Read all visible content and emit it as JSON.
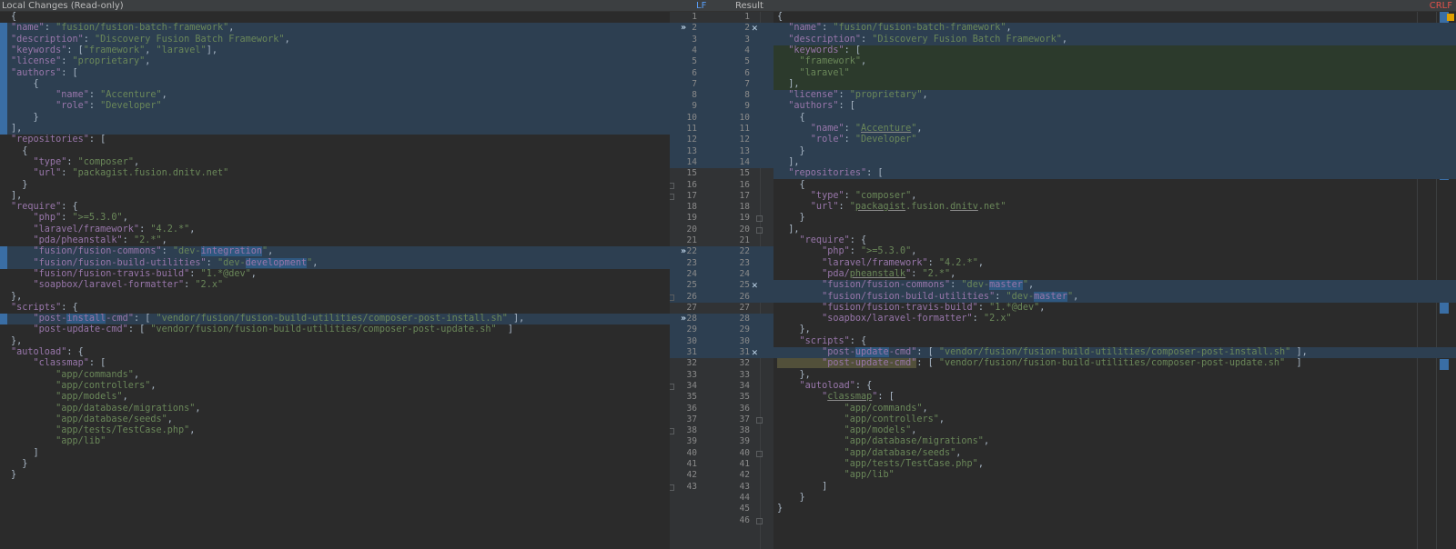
{
  "headers": {
    "left_title": "Local Changes (Read-only)",
    "middle_label": "LF",
    "result_label": "Result",
    "right_label": "CRLF"
  },
  "colors": {
    "accent": "#589df6",
    "changed_band": "#2d3f51",
    "inserted_band": "#2c3a2c",
    "warning": "#e0514b"
  },
  "left_lines": [
    [
      [
        "p",
        "{"
      ]
    ],
    [
      [
        "k",
        "\"name\""
      ],
      [
        "p",
        ": "
      ],
      [
        "s",
        "\"fusion/fusion-batch-framework\""
      ],
      [
        "p",
        ","
      ]
    ],
    [
      [
        "k",
        "\"description\""
      ],
      [
        "p",
        ": "
      ],
      [
        "s",
        "\"Discovery Fusion Batch Framework\""
      ],
      [
        "p",
        ","
      ]
    ],
    [
      [
        "k",
        "\"keywords\""
      ],
      [
        "p",
        ": ["
      ],
      [
        "s",
        "\"framework\""
      ],
      [
        "p",
        ", "
      ],
      [
        "s",
        "\"laravel\""
      ],
      [
        "p",
        "],"
      ]
    ],
    [
      [
        "k",
        "\"license\""
      ],
      [
        "p",
        ": "
      ],
      [
        "s",
        "\"proprietary\""
      ],
      [
        "p",
        ","
      ]
    ],
    [
      [
        "k",
        "\"authors\""
      ],
      [
        "p",
        ": ["
      ]
    ],
    [
      [
        "p",
        "    {"
      ]
    ],
    [
      [
        "k",
        "        \"name\""
      ],
      [
        "p",
        ": "
      ],
      [
        "s",
        "\"Accenture\""
      ],
      [
        "p",
        ","
      ]
    ],
    [
      [
        "k",
        "        \"role\""
      ],
      [
        "p",
        ": "
      ],
      [
        "s",
        "\"Developer\""
      ]
    ],
    [
      [
        "p",
        "    }"
      ]
    ],
    [
      [
        "p",
        "],"
      ]
    ],
    [
      [
        "k",
        "\"repositories\""
      ],
      [
        "p",
        ": ["
      ]
    ],
    [
      [
        "p",
        "  {"
      ]
    ],
    [
      [
        "k",
        "    \"type\""
      ],
      [
        "p",
        ": "
      ],
      [
        "s",
        "\"composer\""
      ],
      [
        "p",
        ","
      ]
    ],
    [
      [
        "k",
        "    \"url\""
      ],
      [
        "p",
        ": "
      ],
      [
        "s",
        "\"packagist.fusion.dnitv.net\""
      ]
    ],
    [
      [
        "p",
        "  }"
      ]
    ],
    [
      [
        "p",
        "],"
      ]
    ],
    [
      [
        "k",
        "\"require\""
      ],
      [
        "p",
        ": {"
      ]
    ],
    [
      [
        "k",
        "    \"php\""
      ],
      [
        "p",
        ": "
      ],
      [
        "s",
        "\">=5.3.0\""
      ],
      [
        "p",
        ","
      ]
    ],
    [
      [
        "k",
        "    \"laravel/framework\""
      ],
      [
        "p",
        ": "
      ],
      [
        "s",
        "\"4.2.*\""
      ],
      [
        "p",
        ","
      ]
    ],
    [
      [
        "k",
        "    \"pda/pheanstalk\""
      ],
      [
        "p",
        ": "
      ],
      [
        "s",
        "\"2.*\""
      ],
      [
        "p",
        ","
      ]
    ],
    [
      [
        "k",
        "    \"fusion/fusion-commons\""
      ],
      [
        "p",
        ": "
      ],
      [
        "s",
        "\"dev-"
      ],
      [
        "hl",
        "integration"
      ],
      [
        "s",
        "\""
      ],
      [
        "p",
        ","
      ]
    ],
    [
      [
        "k",
        "    \"fusion/fusion-build-utilities\""
      ],
      [
        "p",
        ": "
      ],
      [
        "s",
        "\"dev-"
      ],
      [
        "hl",
        "development"
      ],
      [
        "s",
        "\""
      ],
      [
        "p",
        ","
      ]
    ],
    [
      [
        "k",
        "    \"fusion/fusion-travis-build\""
      ],
      [
        "p",
        ": "
      ],
      [
        "s",
        "\"1.*@dev\""
      ],
      [
        "p",
        ","
      ]
    ],
    [
      [
        "k",
        "    \"soapbox/laravel-formatter\""
      ],
      [
        "p",
        ": "
      ],
      [
        "s",
        "\"2.x\""
      ]
    ],
    [
      [
        "p",
        "},"
      ]
    ],
    [
      [
        "k",
        "\"scripts\""
      ],
      [
        "p",
        ": {"
      ]
    ],
    [
      [
        "k",
        "    \"post-"
      ],
      [
        "hl",
        "install"
      ],
      [
        "k",
        "-cmd\""
      ],
      [
        "p",
        ": [ "
      ],
      [
        "s",
        "\"vendor/fusion/fusion-build-utilities/composer-post-install.sh\""
      ],
      [
        "p",
        " ],"
      ]
    ],
    [
      [
        "k",
        "    \"post-update-cmd\""
      ],
      [
        "p",
        ": [ "
      ],
      [
        "s",
        "\"vendor/fusion/fusion-build-utilities/composer-post-update.sh\""
      ],
      [
        "p",
        "  ]"
      ]
    ],
    [
      [
        "p",
        "},"
      ]
    ],
    [
      [
        "k",
        "\"autoload\""
      ],
      [
        "p",
        ": {"
      ]
    ],
    [
      [
        "k",
        "    \"classmap\""
      ],
      [
        "p",
        ": ["
      ]
    ],
    [
      [
        "s",
        "        \"app/commands\""
      ],
      [
        "p",
        ","
      ]
    ],
    [
      [
        "s",
        "        \"app/controllers\""
      ],
      [
        "p",
        ","
      ]
    ],
    [
      [
        "s",
        "        \"app/models\""
      ],
      [
        "p",
        ","
      ]
    ],
    [
      [
        "s",
        "        \"app/database/migrations\""
      ],
      [
        "p",
        ","
      ]
    ],
    [
      [
        "s",
        "        \"app/database/seeds\""
      ],
      [
        "p",
        ","
      ]
    ],
    [
      [
        "s",
        "        \"app/tests/TestCase.php\""
      ],
      [
        "p",
        ","
      ]
    ],
    [
      [
        "s",
        "        \"app/lib\""
      ]
    ],
    [
      [
        "p",
        "    ]"
      ]
    ],
    [
      [
        "p",
        "  }"
      ]
    ],
    [
      [
        "p",
        "}"
      ]
    ],
    [
      [
        "p",
        ""
      ]
    ]
  ],
  "right_lines": [
    [
      [
        "p",
        "{"
      ]
    ],
    [
      [
        "k",
        "  \"name\""
      ],
      [
        "p",
        ": "
      ],
      [
        "s",
        "\"fusion/fusion-batch-framework\""
      ],
      [
        "p",
        ","
      ]
    ],
    [
      [
        "k",
        "  \"description\""
      ],
      [
        "p",
        ": "
      ],
      [
        "s",
        "\"Discovery Fusion Batch Framework\""
      ],
      [
        "p",
        ","
      ]
    ],
    [
      [
        "k",
        "  \"keywords\""
      ],
      [
        "p",
        ": ["
      ]
    ],
    [
      [
        "s",
        "    \"framework\""
      ],
      [
        "p",
        ","
      ]
    ],
    [
      [
        "s",
        "    \"laravel\""
      ]
    ],
    [
      [
        "p",
        "  ],"
      ]
    ],
    [
      [
        "k",
        "  \"license\""
      ],
      [
        "p",
        ": "
      ],
      [
        "s",
        "\"proprietary\""
      ],
      [
        "p",
        ","
      ]
    ],
    [
      [
        "k",
        "  \"authors\""
      ],
      [
        "p",
        ": ["
      ]
    ],
    [
      [
        "p",
        "    {"
      ]
    ],
    [
      [
        "k",
        "      \"name\""
      ],
      [
        "p",
        ": "
      ],
      [
        "s",
        "\""
      ],
      [
        "u",
        "Accenture"
      ],
      [
        "s",
        "\""
      ],
      [
        "p",
        ","
      ]
    ],
    [
      [
        "k",
        "      \"role\""
      ],
      [
        "p",
        ": "
      ],
      [
        "s",
        "\"Developer\""
      ]
    ],
    [
      [
        "p",
        "    }"
      ]
    ],
    [
      [
        "p",
        "  ],"
      ]
    ],
    [
      [
        "k",
        "  \"repositories\""
      ],
      [
        "p",
        ": ["
      ]
    ],
    [
      [
        "p",
        "    {"
      ]
    ],
    [
      [
        "k",
        "      \"type\""
      ],
      [
        "p",
        ": "
      ],
      [
        "s",
        "\"composer\""
      ],
      [
        "p",
        ","
      ]
    ],
    [
      [
        "k",
        "      \"url\""
      ],
      [
        "p",
        ": "
      ],
      [
        "s",
        "\""
      ],
      [
        "u",
        "packagist"
      ],
      [
        "s",
        ".fusion."
      ],
      [
        "u",
        "dnitv"
      ],
      [
        "s",
        ".net\""
      ]
    ],
    [
      [
        "p",
        "    }"
      ]
    ],
    [
      [
        "p",
        "  ],"
      ]
    ],
    [
      [
        "k",
        "    \"require\""
      ],
      [
        "p",
        ": {"
      ]
    ],
    [
      [
        "k",
        "        \"php\""
      ],
      [
        "p",
        ": "
      ],
      [
        "s",
        "\">=5.3.0\""
      ],
      [
        "p",
        ","
      ]
    ],
    [
      [
        "k",
        "        \"laravel/framework\""
      ],
      [
        "p",
        ": "
      ],
      [
        "s",
        "\"4.2.*\""
      ],
      [
        "p",
        ","
      ]
    ],
    [
      [
        "k",
        "        \"pda/"
      ],
      [
        "u",
        "pheanstalk"
      ],
      [
        "k",
        "\""
      ],
      [
        "p",
        ": "
      ],
      [
        "s",
        "\"2.*\""
      ],
      [
        "p",
        ","
      ]
    ],
    [
      [
        "k",
        "        \"fusion/fusion-commons\""
      ],
      [
        "p",
        ": "
      ],
      [
        "s",
        "\"dev-"
      ],
      [
        "hl",
        "master"
      ],
      [
        "s",
        "\""
      ],
      [
        "p",
        ","
      ]
    ],
    [
      [
        "k",
        "        \"fusion/fusion-build-utilities\""
      ],
      [
        "p",
        ": "
      ],
      [
        "s",
        "\"dev-"
      ],
      [
        "hl",
        "master"
      ],
      [
        "s",
        "\""
      ],
      [
        "p",
        ","
      ]
    ],
    [
      [
        "k",
        "        \"fusion/fusion-travis-build\""
      ],
      [
        "p",
        ": "
      ],
      [
        "s",
        "\"1.*@dev\""
      ],
      [
        "p",
        ","
      ]
    ],
    [
      [
        "k",
        "        \"soapbox/laravel-formatter\""
      ],
      [
        "p",
        ": "
      ],
      [
        "s",
        "\"2.x\""
      ]
    ],
    [
      [
        "p",
        "    },"
      ]
    ],
    [
      [
        "k",
        "    \"scripts\""
      ],
      [
        "p",
        ": {"
      ]
    ],
    [
      [
        "k",
        "        \"post-"
      ],
      [
        "hl",
        "update"
      ],
      [
        "k",
        "-cmd\""
      ],
      [
        "p",
        ": [ "
      ],
      [
        "s",
        "\"vendor/fusion/fusion-build-utilities/composer-post-install.sh\""
      ],
      [
        "p",
        " ],"
      ]
    ],
    [
      [
        "hlo",
        "        \"post-update-cmd\""
      ],
      [
        "p",
        ": [ "
      ],
      [
        "s",
        "\"vendor/fusion/fusion-build-utilities/composer-post-update.sh\""
      ],
      [
        "p",
        "  ]"
      ]
    ],
    [
      [
        "p",
        "    },"
      ]
    ],
    [
      [
        "k",
        "    \"autoload\""
      ],
      [
        "p",
        ": {"
      ]
    ],
    [
      [
        "k",
        "        \""
      ],
      [
        "u",
        "classmap"
      ],
      [
        "k",
        "\""
      ],
      [
        "p",
        ": ["
      ]
    ],
    [
      [
        "s",
        "            \"app/commands\""
      ],
      [
        "p",
        ","
      ]
    ],
    [
      [
        "s",
        "            \"app/controllers\""
      ],
      [
        "p",
        ","
      ]
    ],
    [
      [
        "s",
        "            \"app/models\""
      ],
      [
        "p",
        ","
      ]
    ],
    [
      [
        "s",
        "            \"app/database/migrations\""
      ],
      [
        "p",
        ","
      ]
    ],
    [
      [
        "s",
        "            \"app/database/seeds\""
      ],
      [
        "p",
        ","
      ]
    ],
    [
      [
        "s",
        "            \"app/tests/TestCase.php\""
      ],
      [
        "p",
        ","
      ]
    ],
    [
      [
        "s",
        "            \"app/lib\""
      ]
    ],
    [
      [
        "p",
        "        ]"
      ]
    ],
    [
      [
        "p",
        "    }"
      ]
    ],
    [
      [
        "p",
        "}"
      ]
    ],
    [
      [
        "p",
        ""
      ]
    ]
  ],
  "left_line_numbers": [
    1,
    2,
    3,
    4,
    5,
    6,
    7,
    8,
    9,
    10,
    11,
    12,
    13,
    14,
    15,
    16,
    17,
    18,
    19,
    20,
    21,
    22,
    23,
    24,
    25,
    26,
    27,
    28,
    29,
    30,
    31,
    32,
    33,
    34,
    35,
    36,
    37,
    38,
    39,
    40,
    41,
    42,
    43
  ],
  "right_line_numbers": [
    1,
    2,
    3,
    4,
    5,
    6,
    7,
    8,
    9,
    10,
    11,
    12,
    13,
    14,
    15,
    16,
    17,
    18,
    19,
    20,
    21,
    22,
    23,
    24,
    25,
    26,
    27,
    28,
    29,
    30,
    31,
    32,
    33,
    34,
    35,
    36,
    37,
    38,
    39,
    40,
    41,
    42,
    43,
    44,
    45,
    46
  ],
  "apply_arrow": "»",
  "ignore_cross": "✕"
}
